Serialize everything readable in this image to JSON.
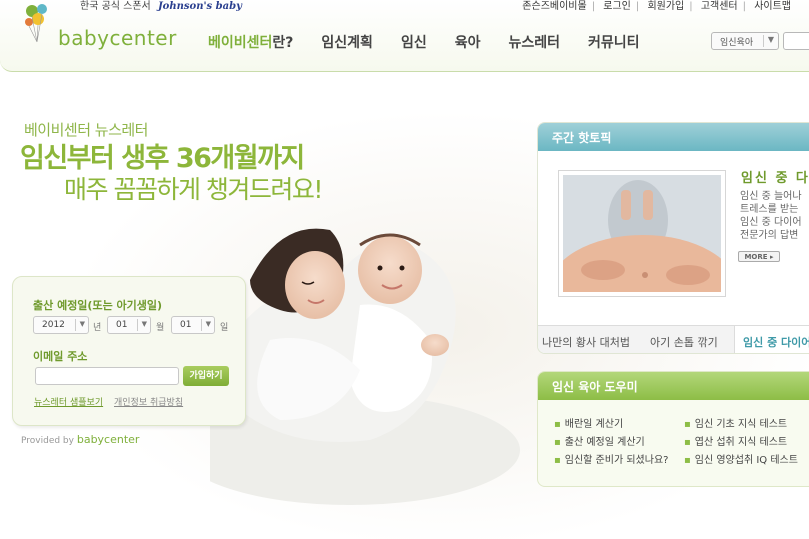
{
  "header": {
    "logo_text": "babycenter",
    "tagline_ko": "한국 공식 스폰서",
    "tagline_brand": "Johnson's baby",
    "top_links": [
      "존슨즈베이비몰",
      "로그인",
      "회원가입",
      "고객센터",
      "사이트맵"
    ],
    "nav": [
      "베이비센터란?",
      "임신계획",
      "임신",
      "육아",
      "뉴스레터",
      "커뮤니티"
    ],
    "nav_first_green": "베이비센터",
    "nav_first_rest": "란?",
    "select_value": "임신육아"
  },
  "hero": {
    "line1": "베이비센터 뉴스레터",
    "line2": "임신부터 생후 36개월까지",
    "line3": "매주 꼼꼼하게 챙겨드려요!"
  },
  "signup": {
    "date_label": "출산 예정일(또는 아기생일)",
    "year": "2012",
    "year_unit": "년",
    "month": "01",
    "month_unit": "월",
    "day": "01",
    "day_unit": "일",
    "email_label": "이메일 주소",
    "email_value": "",
    "join_button": "가입하기",
    "sample_link": "뉴스레터 샘플보기",
    "privacy_link": "개인정보 취급방침",
    "provided_by": "Provided by",
    "provided_brand": "babycenter"
  },
  "weekly": {
    "header": "주간 핫토픽",
    "title": "임신 중 다",
    "desc": [
      "임신 중 늘어나",
      "트레스를 받는",
      "임신 중 다이어",
      "전문가의 답변"
    ],
    "more_button": "MORE",
    "tabs": [
      "나만의 황사 대처법",
      "아기 손톱 깎기",
      "임신 중 다이어"
    ]
  },
  "tools": {
    "header": "임신 육아 도우미",
    "left": [
      "배란일 계산기",
      "출산 예정일 계산기",
      "임신할 준비가 되셨나요?"
    ],
    "right": [
      "임신 기초 지식 테스트",
      "엽산 섭취 지식 테스트",
      "임신 영양섭취 IQ 테스트"
    ]
  }
}
